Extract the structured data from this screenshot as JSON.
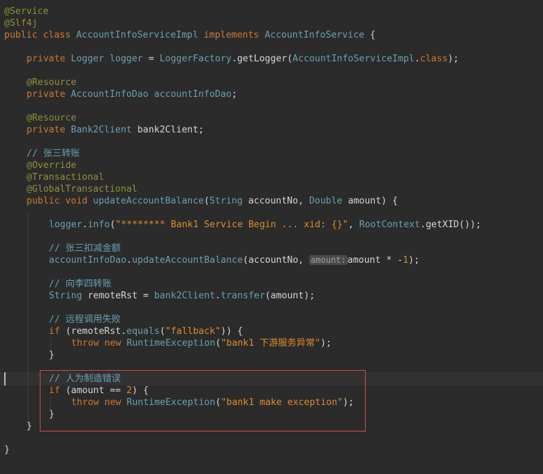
{
  "code_lines": [
    {
      "id": "l1",
      "parts": [
        [
          "an",
          "@Service"
        ]
      ]
    },
    {
      "id": "l2",
      "parts": [
        [
          "an",
          "@Slf4j"
        ]
      ]
    },
    {
      "id": "l3",
      "parts": [
        [
          "kw",
          "public class "
        ],
        [
          "cls",
          "AccountInfoServiceImpl "
        ],
        [
          "kw",
          "implements "
        ],
        [
          "cls",
          "AccountInfoService "
        ],
        [
          "txt",
          "{"
        ]
      ]
    },
    {
      "id": "l4",
      "parts": [
        [
          "kw",
          "private "
        ],
        [
          "cls",
          "Logger "
        ],
        [
          "mth",
          "logger "
        ],
        [
          "txt",
          "= "
        ],
        [
          "cls",
          "LoggerFactory"
        ],
        [
          "txt",
          ".getLogger("
        ],
        [
          "cls",
          "AccountInfoServiceImpl"
        ],
        [
          "txt",
          "."
        ],
        [
          "kw",
          "class"
        ],
        [
          "txt",
          ");"
        ]
      ]
    },
    {
      "id": "l5",
      "parts": [
        [
          "an",
          "@Resource"
        ]
      ]
    },
    {
      "id": "l6",
      "parts": [
        [
          "kw",
          "private "
        ],
        [
          "cls",
          "AccountInfoDao "
        ],
        [
          "mth",
          "accountInfoDao"
        ],
        [
          "txt",
          ";"
        ]
      ]
    },
    {
      "id": "l7",
      "parts": [
        [
          "an",
          "@Resource"
        ]
      ]
    },
    {
      "id": "l8",
      "parts": [
        [
          "kw",
          "private "
        ],
        [
          "cls",
          "Bank2Client "
        ],
        [
          "txt",
          "bank2Client;"
        ]
      ]
    },
    {
      "id": "l9",
      "parts": [
        [
          "cm",
          "// 张三转账"
        ]
      ]
    },
    {
      "id": "l10",
      "parts": [
        [
          "an",
          "@Override"
        ]
      ]
    },
    {
      "id": "l11",
      "parts": [
        [
          "an",
          "@Transactional"
        ]
      ]
    },
    {
      "id": "l12",
      "parts": [
        [
          "an",
          "@GlobalTransactional"
        ]
      ]
    },
    {
      "id": "l13",
      "parts": [
        [
          "kw",
          "public void "
        ],
        [
          "mth",
          "updateAccountBalance"
        ],
        [
          "txt",
          "("
        ],
        [
          "cls",
          "String "
        ],
        [
          "txt",
          "accountNo, "
        ],
        [
          "cls",
          "Double "
        ],
        [
          "txt",
          "amount) {"
        ]
      ]
    },
    {
      "id": "l14",
      "parts": [
        [
          "mth",
          "logger"
        ],
        [
          "txt",
          "."
        ],
        [
          "mth",
          "info"
        ],
        [
          "txt",
          "("
        ],
        [
          "str",
          "\"******** Bank1 Service Begin ... xid: {}\""
        ],
        [
          "txt",
          ", "
        ],
        [
          "cls",
          "RootContext"
        ],
        [
          "txt",
          ".getXID());"
        ]
      ]
    },
    {
      "id": "l15",
      "parts": [
        [
          "cm",
          "// 张三扣减金额"
        ]
      ]
    },
    {
      "id": "l16",
      "parts": [
        [
          "mth",
          "accountInfoDao"
        ],
        [
          "txt",
          "."
        ],
        [
          "mth",
          "updateAccountBalance"
        ],
        [
          "txt",
          "(accountNo, "
        ],
        [
          "hint",
          "amount:"
        ],
        [
          "txt",
          "amount * -"
        ],
        [
          "num",
          "1"
        ],
        [
          "txt",
          ");"
        ]
      ]
    },
    {
      "id": "l17",
      "parts": [
        [
          "cm",
          "// 向李四转账"
        ]
      ]
    },
    {
      "id": "l18",
      "parts": [
        [
          "cls",
          "String "
        ],
        [
          "txt",
          "remoteRst = "
        ],
        [
          "mth",
          "bank2Client"
        ],
        [
          "txt",
          "."
        ],
        [
          "mth",
          "transfer"
        ],
        [
          "txt",
          "(amount);"
        ]
      ]
    },
    {
      "id": "l19",
      "parts": [
        [
          "cm",
          "// 远程调用失败"
        ]
      ]
    },
    {
      "id": "l20",
      "parts": [
        [
          "kw",
          "if "
        ],
        [
          "txt",
          "(remoteRst."
        ],
        [
          "mth",
          "equals"
        ],
        [
          "txt",
          "("
        ],
        [
          "str",
          "\"fallback\""
        ],
        [
          "txt",
          ")) {"
        ]
      ]
    },
    {
      "id": "l21",
      "parts": [
        [
          "kw",
          "throw new "
        ],
        [
          "cls",
          "RuntimeException"
        ],
        [
          "txt",
          "("
        ],
        [
          "str",
          "\"bank1 下游服务异常\""
        ],
        [
          "txt",
          ");"
        ]
      ]
    },
    {
      "id": "l22",
      "parts": [
        [
          "txt",
          "}"
        ]
      ]
    },
    {
      "id": "l23",
      "parts": [
        [
          "cm",
          "// 人为制造错误"
        ]
      ]
    },
    {
      "id": "l24",
      "parts": [
        [
          "kw",
          "if "
        ],
        [
          "txt",
          "(amount == "
        ],
        [
          "num",
          "2"
        ],
        [
          "txt",
          ") {"
        ]
      ]
    },
    {
      "id": "l25",
      "parts": [
        [
          "kw",
          "throw new "
        ],
        [
          "cls",
          "RuntimeException"
        ],
        [
          "txt",
          "("
        ],
        [
          "str",
          "\"bank1 make exception\""
        ],
        [
          "txt",
          ");"
        ]
      ]
    },
    {
      "id": "l26",
      "parts": [
        [
          "txt",
          "}"
        ]
      ]
    },
    {
      "id": "l27",
      "parts": [
        [
          "txt",
          "}"
        ]
      ]
    },
    {
      "id": "l28",
      "parts": [
        [
          "txt",
          "}"
        ]
      ]
    }
  ]
}
